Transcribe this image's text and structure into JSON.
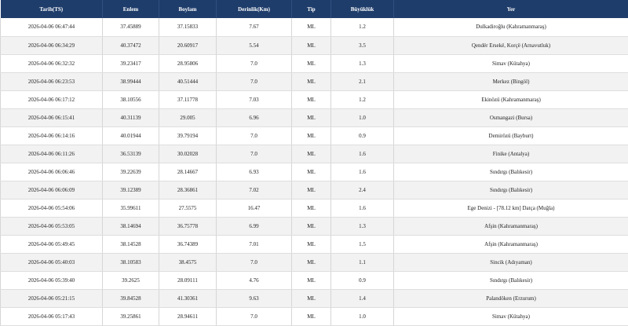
{
  "columns": {
    "date": "Tarih(TS)",
    "lat": "Enlem",
    "lon": "Boylam",
    "depth": "Derinlik(Km)",
    "type": "Tip",
    "mag": "Büyüklük",
    "place": "Yer"
  },
  "rows": [
    {
      "date": "2026-04-06 06:47:44",
      "lat": "37.45889",
      "lon": "37.15833",
      "depth": "7.67",
      "type": "ML",
      "mag": "1.2",
      "place": "Dulkadiroğlu (Kahramanmaraş)"
    },
    {
      "date": "2026-04-06 06:34:29",
      "lat": "40.37472",
      "lon": "20.60917",
      "depth": "5.54",
      "type": "ML",
      "mag": "3.5",
      "place": "Qendër Ersekë, Korçë (Arnavutluk)"
    },
    {
      "date": "2026-04-06 06:32:32",
      "lat": "39.23417",
      "lon": "28.95806",
      "depth": "7.0",
      "type": "ML",
      "mag": "1.3",
      "place": "Simav (Kütahya)"
    },
    {
      "date": "2026-04-06 06:23:53",
      "lat": "38.99444",
      "lon": "40.51444",
      "depth": "7.0",
      "type": "ML",
      "mag": "2.1",
      "place": "Merkez (Bingöl)"
    },
    {
      "date": "2026-04-06 06:17:12",
      "lat": "38.10556",
      "lon": "37.11778",
      "depth": "7.03",
      "type": "ML",
      "mag": "1.2",
      "place": "Ekinözü (Kahramanmaraş)"
    },
    {
      "date": "2026-04-06 06:15:41",
      "lat": "40.31139",
      "lon": "29.005",
      "depth": "6.96",
      "type": "ML",
      "mag": "1.0",
      "place": "Osmangazi (Bursa)"
    },
    {
      "date": "2026-04-06 06:14:16",
      "lat": "40.01944",
      "lon": "39.79194",
      "depth": "7.0",
      "type": "ML",
      "mag": "0.9",
      "place": "Demirözü (Bayburt)"
    },
    {
      "date": "2026-04-06 06:11:26",
      "lat": "36.53139",
      "lon": "30.02028",
      "depth": "7.0",
      "type": "ML",
      "mag": "1.6",
      "place": "Finike (Antalya)"
    },
    {
      "date": "2026-04-06 06:06:46",
      "lat": "39.22639",
      "lon": "28.14667",
      "depth": "6.93",
      "type": "ML",
      "mag": "1.6",
      "place": "Sındırgı (Balıkesir)"
    },
    {
      "date": "2026-04-06 06:06:09",
      "lat": "39.12389",
      "lon": "28.36861",
      "depth": "7.02",
      "type": "ML",
      "mag": "2.4",
      "place": "Sındırgı (Balıkesir)"
    },
    {
      "date": "2026-04-06 05:54:06",
      "lat": "35.99611",
      "lon": "27.5575",
      "depth": "16.47",
      "type": "ML",
      "mag": "1.6",
      "place": "Ege Denizi - [78.12 km] Datça (Muğla)"
    },
    {
      "date": "2026-04-06 05:53:05",
      "lat": "38.14694",
      "lon": "36.75778",
      "depth": "6.99",
      "type": "ML",
      "mag": "1.3",
      "place": "Afşin (Kahramanmaraş)"
    },
    {
      "date": "2026-04-06 05:49:45",
      "lat": "38.14528",
      "lon": "36.74389",
      "depth": "7.01",
      "type": "ML",
      "mag": "1.5",
      "place": "Afşin (Kahramanmaraş)"
    },
    {
      "date": "2026-04-06 05:40:03",
      "lat": "38.10583",
      "lon": "38.4575",
      "depth": "7.0",
      "type": "ML",
      "mag": "1.1",
      "place": "Sincik (Adıyaman)"
    },
    {
      "date": "2026-04-06 05:39:40",
      "lat": "39.2625",
      "lon": "28.09111",
      "depth": "4.76",
      "type": "ML",
      "mag": "0.9",
      "place": "Sındırgı (Balıkesir)"
    },
    {
      "date": "2026-04-06 05:21:15",
      "lat": "39.84528",
      "lon": "41.30361",
      "depth": "9.63",
      "type": "ML",
      "mag": "1.4",
      "place": "Palandöken (Erzurum)"
    },
    {
      "date": "2026-04-06 05:17:43",
      "lat": "39.25861",
      "lon": "28.94611",
      "depth": "7.0",
      "type": "ML",
      "mag": "1.0",
      "place": "Simav (Kütahya)"
    }
  ]
}
